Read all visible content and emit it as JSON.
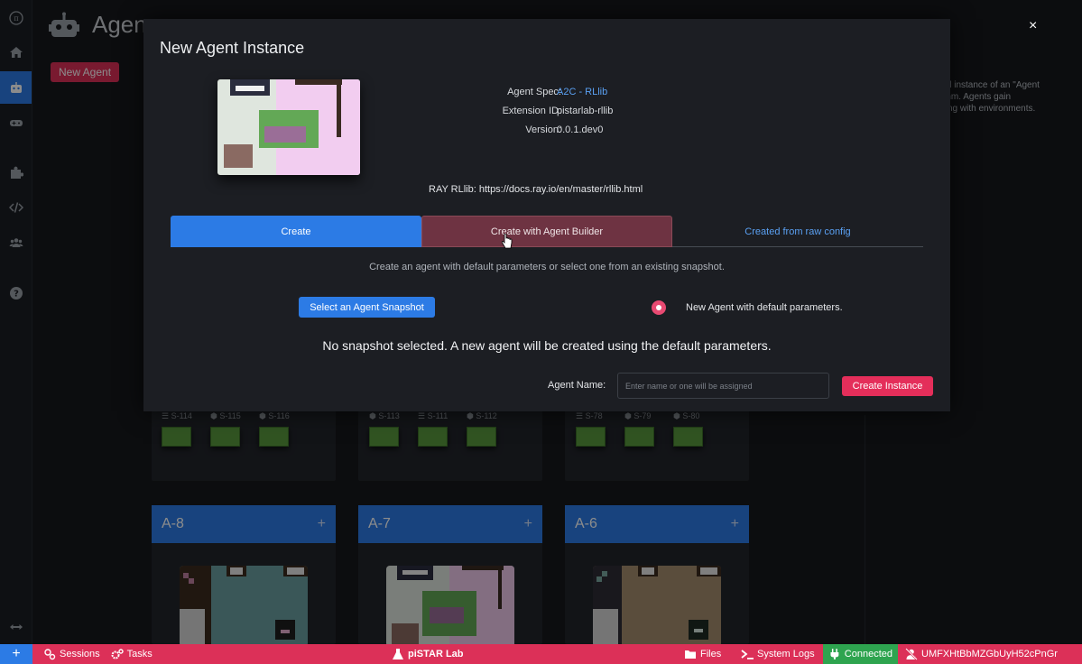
{
  "page": {
    "title": "Agen",
    "new_agent_label": "New Agent",
    "right_info_text": "red instance of an \"Agent\nrithm. Agents gain\ncting with environments."
  },
  "cards": [
    {
      "label": "A-8",
      "plus": "+"
    },
    {
      "label": "A-7",
      "plus": "+"
    },
    {
      "label": "A-6",
      "plus": "+"
    }
  ],
  "snapshots": {
    "group1": [
      "S-114",
      "S-115",
      "S-116"
    ],
    "group2": [
      "S-113",
      "S-111",
      "S-112"
    ],
    "group3": [
      "S-78",
      "S-79",
      "S-80"
    ]
  },
  "modal": {
    "title": "New Agent Instance",
    "close_glyph": "×",
    "spec_key": "Agent Spec:",
    "spec_value": "A2C - RLlib",
    "ext_key": "Extension ID:",
    "ext_value": "pistarlab-rllib",
    "ver_key": "Version:",
    "ver_value": "0.0.1.dev0",
    "ray_line": "RAY RLlib: https://docs.ray.io/en/master/rllib.html",
    "tabs": [
      "Create",
      "Create with Agent Builder",
      "Created from raw config"
    ],
    "hint": "Create an agent with default parameters or select one from an existing snapshot.",
    "snapshot_button": "Select an Agent Snapshot",
    "radio_label": "New Agent with default parameters.",
    "status_message": "No snapshot selected. A new agent will be created using the default parameters.",
    "name_label": "Agent Name:",
    "name_placeholder": "Enter name or one will be assigned",
    "create_button": "Create Instance"
  },
  "statusbar": {
    "sessions": "Sessions",
    "tasks": "Tasks",
    "brand": "piSTAR Lab",
    "files": "Files",
    "logs": "System Logs",
    "connected": "Connected",
    "user": "UMFXHtBbMZGbUyH52cPnGr"
  },
  "colors": {
    "accent": "#2c7be5",
    "danger": "#dc3058",
    "success": "#2ea44f"
  }
}
